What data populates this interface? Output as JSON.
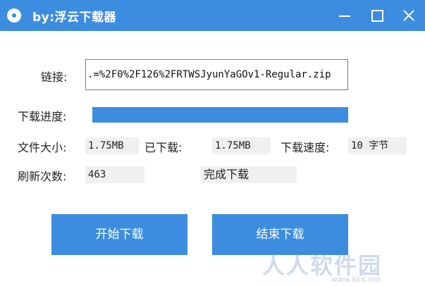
{
  "window": {
    "title": "by:浮云下载器"
  },
  "link": {
    "label": "链接:",
    "value": ".=%2F0%2F126%2FRTWSJyunYaGOv1-Regular.zip"
  },
  "progress": {
    "label": "下载进度:",
    "fraction": 1.0
  },
  "stats": {
    "file_size_label": "文件大小:",
    "file_size_value": "1.75MB",
    "downloaded_label": "已下载:",
    "downloaded_value": "1.75MB",
    "speed_label": "下载速度:",
    "speed_value": "10 字节",
    "refresh_label": "刷新次数:",
    "refresh_value": "463",
    "status_text": "完成下载"
  },
  "buttons": {
    "start_label": "开始下载",
    "stop_label": "结束下载"
  },
  "colors": {
    "accent": "#3c8de0"
  },
  "watermark": {
    "main": "人人软件园",
    "sub": "www.kkx.net"
  }
}
